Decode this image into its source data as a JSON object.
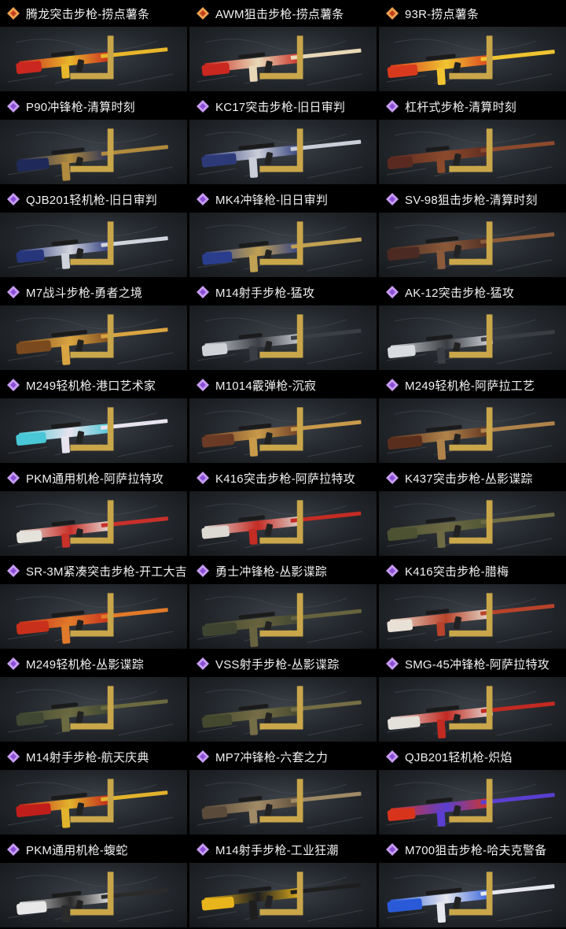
{
  "items": [
    {
      "name": "腾龙突击步枪-捞点薯条",
      "rarity": "legendary",
      "palette": [
        "#c9271f",
        "#e8b62a"
      ]
    },
    {
      "name": "AWM狙击步枪-捞点薯条",
      "rarity": "legendary",
      "palette": [
        "#c9271f",
        "#e8d8b8"
      ]
    },
    {
      "name": "93R-捞点薯条",
      "rarity": "legendary",
      "palette": [
        "#d93a1e",
        "#f0c431"
      ]
    },
    {
      "name": "P90冲锋枪-清算时刻",
      "rarity": "epic",
      "palette": [
        "#1f2a5a",
        "#b08a3e"
      ]
    },
    {
      "name": "KC17突击步枪-旧日审判",
      "rarity": "epic",
      "palette": [
        "#2e3a78",
        "#c9ced8"
      ]
    },
    {
      "name": "杠杆式步枪-清算时刻",
      "rarity": "epic",
      "palette": [
        "#5a2a20",
        "#8c4a2c"
      ]
    },
    {
      "name": "QJB201轻机枪-旧日审判",
      "rarity": "epic",
      "palette": [
        "#27357a",
        "#cfd3dc"
      ]
    },
    {
      "name": "MK4冲锋枪-旧日审判",
      "rarity": "epic",
      "palette": [
        "#2a3d8c",
        "#c0a052"
      ]
    },
    {
      "name": "SV-98狙击步枪-清算时刻",
      "rarity": "epic",
      "palette": [
        "#4a2a22",
        "#8b5a3a"
      ]
    },
    {
      "name": "M7战斗步枪-勇者之境",
      "rarity": "epic",
      "palette": [
        "#7a4a1e",
        "#d9a441"
      ]
    },
    {
      "name": "M14射手步枪-猛攻",
      "rarity": "epic",
      "palette": [
        "#cfd3d8",
        "#3b3e44"
      ]
    },
    {
      "name": "AK-12突击步枪-猛攻",
      "rarity": "epic",
      "palette": [
        "#d8dce0",
        "#3a3d42"
      ]
    },
    {
      "name": "M249轻机枪-港口艺术家",
      "rarity": "epic",
      "palette": [
        "#49c7d6",
        "#e7e3ee"
      ]
    },
    {
      "name": "M1014霰弹枪-沉寂",
      "rarity": "epic",
      "palette": [
        "#6b3a24",
        "#c89a4a"
      ]
    },
    {
      "name": "M249轻机枪-阿萨拉工艺",
      "rarity": "epic",
      "palette": [
        "#5a2e1c",
        "#b0834a"
      ]
    },
    {
      "name": "PKM通用机枪-阿萨拉特攻",
      "rarity": "epic",
      "palette": [
        "#e5e2dc",
        "#c8302a"
      ]
    },
    {
      "name": "K416突击步枪-阿萨拉特攻",
      "rarity": "epic",
      "palette": [
        "#dcd8d2",
        "#c42c24"
      ]
    },
    {
      "name": "K437突击步枪-丛影谍踪",
      "rarity": "epic",
      "palette": [
        "#4c5232",
        "#6d6a44"
      ]
    },
    {
      "name": "SR-3M紧凑突击步枪-开工大吉",
      "rarity": "epic",
      "palette": [
        "#c8301c",
        "#e07a2a"
      ]
    },
    {
      "name": "勇士冲锋枪-丛影谍踪",
      "rarity": "epic",
      "palette": [
        "#3e4430",
        "#67633e"
      ]
    },
    {
      "name": "K416突击步枪-腊梅",
      "rarity": "epic",
      "palette": [
        "#e9e1d6",
        "#b8432a"
      ]
    },
    {
      "name": "M249轻机枪-丛影谍踪",
      "rarity": "epic",
      "palette": [
        "#3f4632",
        "#6b6a40"
      ]
    },
    {
      "name": "VSS射手步枪-丛影谍踪",
      "rarity": "epic",
      "palette": [
        "#43482f",
        "#756d45"
      ]
    },
    {
      "name": "SMG-45冲锋枪-阿萨拉特攻",
      "rarity": "epic",
      "palette": [
        "#e4e0da",
        "#c22a22"
      ]
    },
    {
      "name": "M14射手步枪-航天庆典",
      "rarity": "epic",
      "palette": [
        "#c01e1a",
        "#e2b32c"
      ]
    },
    {
      "name": "MP7冲锋枪-六套之力",
      "rarity": "epic",
      "palette": [
        "#5a4a3a",
        "#a08a66"
      ]
    },
    {
      "name": "QJB201轻机枪-炽焰",
      "rarity": "epic",
      "palette": [
        "#d8341c",
        "#5a3fd0"
      ]
    },
    {
      "name": "PKM通用机枪-蝮蛇",
      "rarity": "epic",
      "palette": [
        "#e8e8e8",
        "#2b2b2b"
      ]
    },
    {
      "name": "M14射手步枪-工业狂潮",
      "rarity": "epic",
      "palette": [
        "#e9b51c",
        "#1e1e1e"
      ]
    },
    {
      "name": "M700狙击步枪-哈夫克警备",
      "rarity": "epic",
      "palette": [
        "#2a5ad8",
        "#e6e8ee"
      ]
    }
  ],
  "colors": {
    "legendary_outer": "#f0a050",
    "legendary_inner": "#c2411c",
    "epic_outer": "#c79cf2",
    "epic_inner": "#8b4fd6"
  }
}
